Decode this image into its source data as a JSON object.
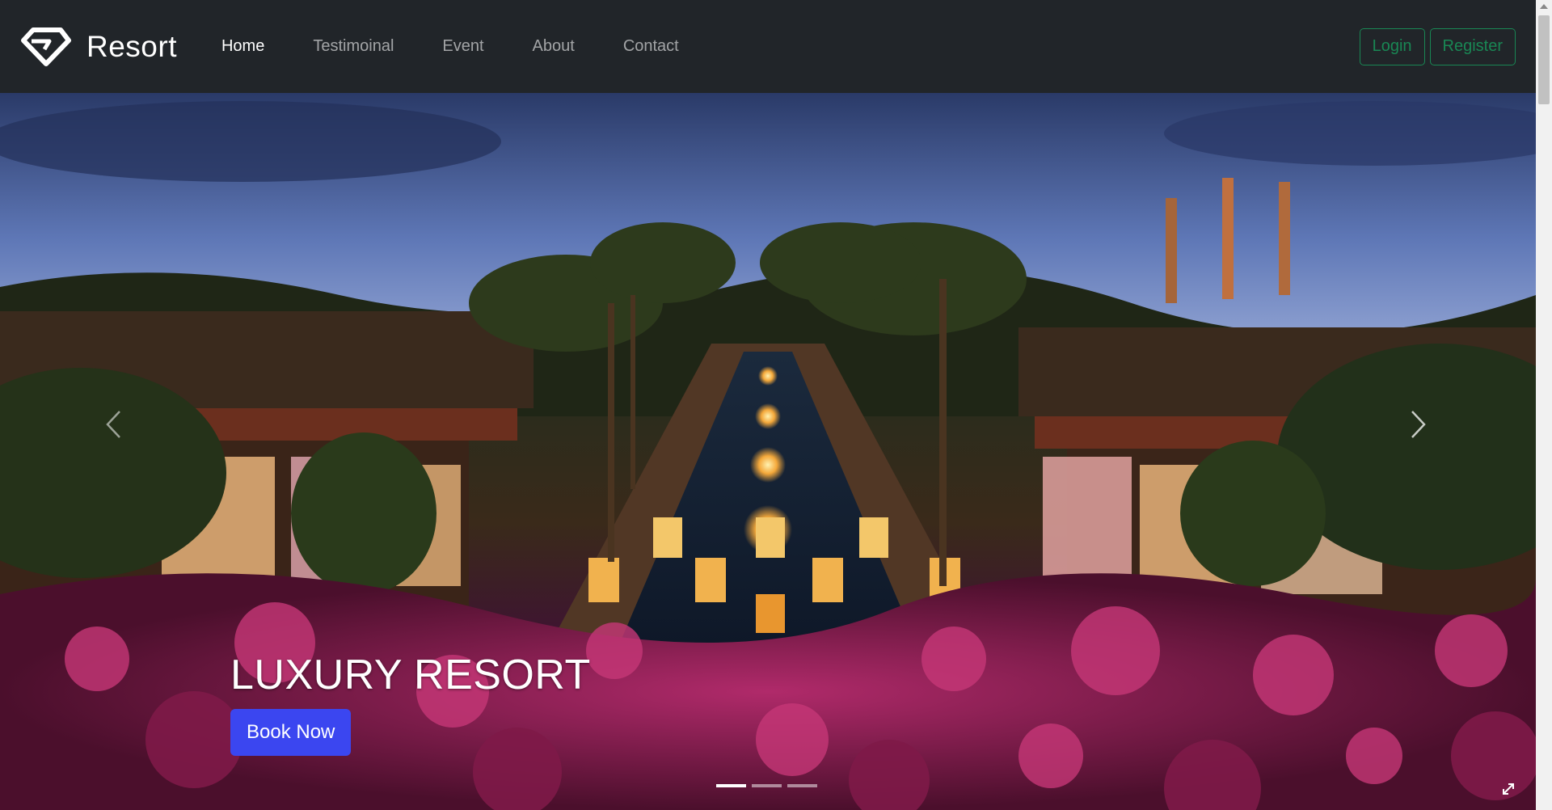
{
  "brand": {
    "name": "Resort",
    "icon": "diamond-logo-icon"
  },
  "nav": {
    "items": [
      {
        "label": "Home",
        "active": true
      },
      {
        "label": "Testimoinal",
        "active": false
      },
      {
        "label": "Event",
        "active": false
      },
      {
        "label": "About",
        "active": false
      },
      {
        "label": "Contact",
        "active": false
      }
    ],
    "login_label": "Login",
    "register_label": "Register"
  },
  "hero": {
    "title": "LUXURY RESORT",
    "cta_label": "Book Now",
    "slide_count": 3,
    "active_slide": 1
  },
  "colors": {
    "navbar_bg": "#212529",
    "outline_button": "#198754",
    "cta_button": "#3b46f0"
  }
}
